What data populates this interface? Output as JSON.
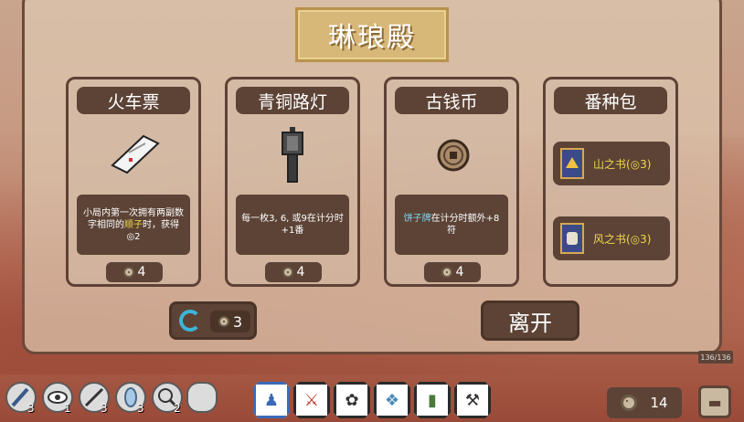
{
  "shop": {
    "title": "琳琅殿",
    "cards": [
      {
        "name": "火车票",
        "icon": "train-ticket-icon",
        "desc_pre": "小局内第一次拥有两副数字相同的",
        "desc_hl": "顺子",
        "desc_post": "时，获得◎2",
        "price": "4"
      },
      {
        "name": "青铜路灯",
        "icon": "bronze-lamp-icon",
        "desc_pre": "每一枚3, 6, 或9在计分时+1番",
        "desc_hl": "",
        "desc_post": "",
        "price": "4"
      },
      {
        "name": "古钱币",
        "icon": "ancient-coin-icon",
        "desc_pre": "",
        "desc_hl": "饼子牌",
        "desc_post": "在计分时额外+8符",
        "price": "4"
      }
    ],
    "pack": {
      "name": "番种包",
      "items": [
        {
          "label": "山之书(◎3)",
          "icon": "mountain-book-icon"
        },
        {
          "label": "风之书(◎3)",
          "icon": "wind-book-icon"
        }
      ]
    },
    "refresh_price": "3",
    "leave_label": "离开",
    "deck_count": "136/136"
  },
  "inventory": {
    "items": [
      {
        "icon": "brush-icon",
        "count": "3"
      },
      {
        "icon": "eye-icon",
        "count": "1"
      },
      {
        "icon": "sword-icon",
        "count": "3"
      },
      {
        "icon": "crystal-icon",
        "count": "3"
      },
      {
        "icon": "search-icon",
        "count": "2"
      },
      {
        "icon": "empty-slot-icon",
        "count": ""
      }
    ],
    "tiles": [
      {
        "icon": "blue-figure-tile-icon",
        "glyph": "♟"
      },
      {
        "icon": "knife-tile-icon",
        "glyph": "⚔"
      },
      {
        "icon": "flower-tile-icon",
        "glyph": "✿"
      },
      {
        "icon": "crystal-tile-icon",
        "glyph": "❖"
      },
      {
        "icon": "bamboo-tile-icon",
        "glyph": "▮"
      },
      {
        "icon": "tool-tile-icon",
        "glyph": "⚒"
      }
    ]
  },
  "money": "14",
  "colors": {
    "panel_brown": "#5c4336",
    "highlight_yellow": "#f0d84a",
    "highlight_cyan": "#7fd6f0",
    "title_gold": "#d8b878"
  }
}
